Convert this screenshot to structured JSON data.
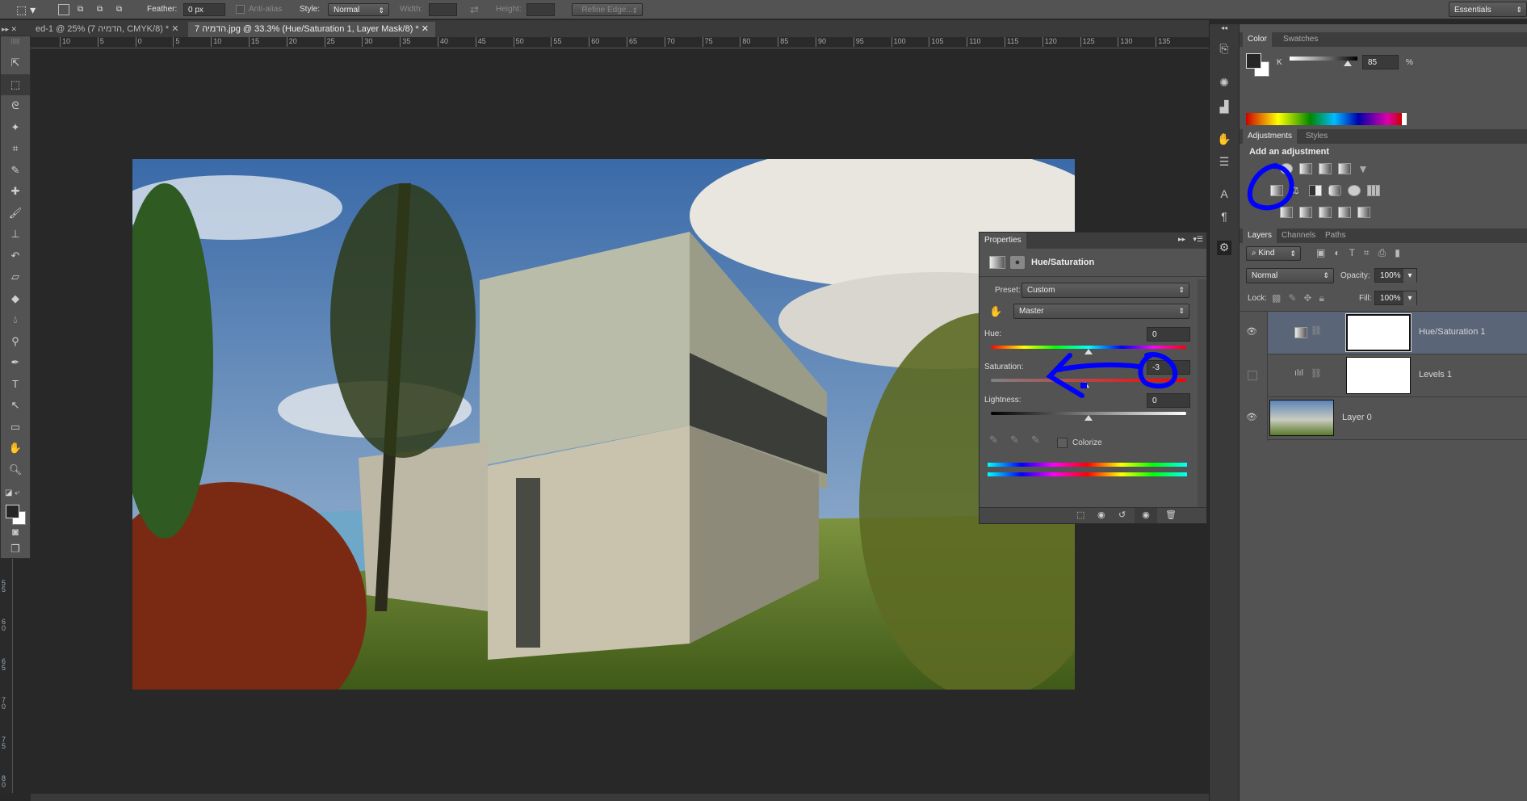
{
  "options_bar": {
    "feather_label": "Feather:",
    "feather_value": "0 px",
    "anti_alias_label": "Anti-alias",
    "style_label": "Style:",
    "style_value": "Normal",
    "width_label": "Width:",
    "height_label": "Height:",
    "refine_edge_label": "Refine Edge...",
    "workspace": "Essentials"
  },
  "document_tabs": [
    {
      "label": "ed-1 @ 25% (7 הדמיה, CMYK/8) *",
      "active": false
    },
    {
      "label": "7 הדמיה.jpg @ 33.3% (Hue/Saturation 1, Layer Mask/8) *",
      "active": true
    }
  ],
  "ruler": {
    "horizontal": [
      "10",
      "5",
      "0",
      "5",
      "10",
      "15",
      "20",
      "25",
      "30",
      "35",
      "40",
      "45",
      "50",
      "55",
      "60",
      "65",
      "70",
      "75",
      "80",
      "85",
      "90",
      "95",
      "100",
      "105",
      "110",
      "115",
      "120",
      "125",
      "130",
      "135"
    ],
    "vertical": [
      "55",
      "60",
      "65",
      "70",
      "75",
      "80"
    ]
  },
  "tools": [
    "move",
    "rectangular-marquee",
    "lasso",
    "magic-wand",
    "crop",
    "eyedropper",
    "spot-healing",
    "brush",
    "clone-stamp",
    "history-brush",
    "eraser",
    "paint-bucket",
    "blur",
    "dodge",
    "pen",
    "type",
    "path-selection",
    "rectangle",
    "hand",
    "zoom"
  ],
  "color_panel": {
    "tabs": [
      "Color",
      "Swatches"
    ],
    "channel_label": "K",
    "channel_value": "85",
    "unit": "%",
    "foreground": "#262626",
    "background": "#ffffff"
  },
  "adjustments_panel": {
    "tabs": [
      "Adjustments",
      "Styles"
    ],
    "heading": "Add an adjustment"
  },
  "layers_panel": {
    "tabs": [
      "Layers",
      "Channels",
      "Paths"
    ],
    "filter_kind": "Kind",
    "blend_mode": "Normal",
    "opacity_label": "Opacity:",
    "opacity_value": "100%",
    "lock_label": "Lock:",
    "fill_label": "Fill:",
    "fill_value": "100%",
    "layers": [
      {
        "name": "Hue/Saturation 1",
        "visible": true,
        "selected": true
      },
      {
        "name": "Levels 1",
        "visible": false,
        "selected": false
      },
      {
        "name": "Layer 0",
        "visible": true,
        "selected": false
      }
    ]
  },
  "properties_panel": {
    "tab": "Properties",
    "title": "Hue/Saturation",
    "preset_label": "Preset:",
    "preset_value": "Custom",
    "channel_value": "Master",
    "hue_label": "Hue:",
    "hue_value": "0",
    "saturation_label": "Saturation:",
    "saturation_value": "-3",
    "lightness_label": "Lightness:",
    "lightness_value": "0",
    "colorize_label": "Colorize",
    "colorize_checked": false
  },
  "annotation_color": "#0000ff"
}
